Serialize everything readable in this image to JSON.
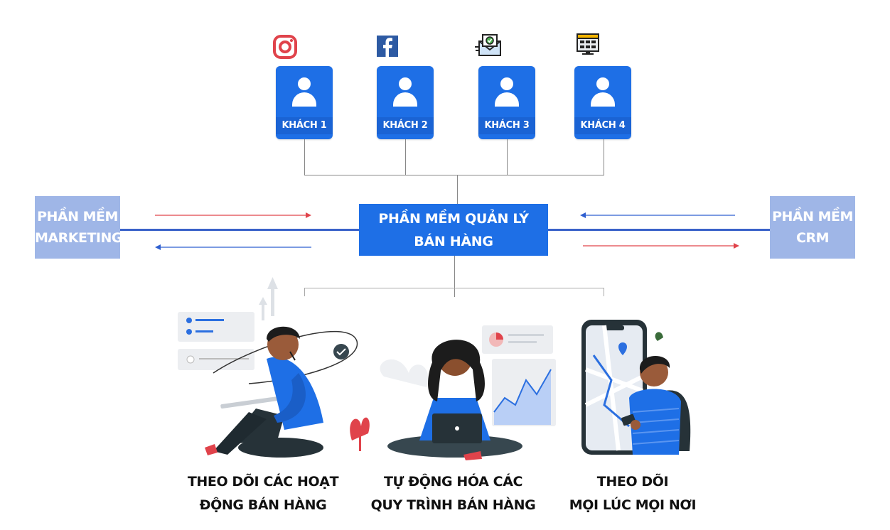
{
  "customers": [
    {
      "label": "KHÁCH 1",
      "channel_icon": "instagram-icon"
    },
    {
      "label": "KHÁCH 2",
      "channel_icon": "facebook-icon"
    },
    {
      "label": "KHÁCH 3",
      "channel_icon": "email-icon"
    },
    {
      "label": "KHÁCH 4",
      "channel_icon": "website-icon"
    }
  ],
  "center": {
    "line1": "PHẦN MỀM QUẢN LÝ",
    "line2": "BÁN HÀNG"
  },
  "left_system": {
    "line1": "PHẦN MỀM",
    "line2": "MARKETING"
  },
  "right_system": {
    "line1": "PHẦN MỀM",
    "line2": "CRM"
  },
  "features": [
    {
      "line1": "THEO DÕI CÁC HOẠT",
      "line2": "ĐỘNG BÁN HÀNG"
    },
    {
      "line1": "TỰ ĐỘNG HÓA CÁC",
      "line2": "QUY TRÌNH BÁN HÀNG"
    },
    {
      "line1": "THEO DÕI",
      "line2": "MỌI LÚC MỌI NƠI"
    }
  ],
  "colors": {
    "primary_blue": "#1e6fe6",
    "light_blue": "#9fb6e7",
    "arrow_red": "#e0434b",
    "arrow_blue": "#2f5fd0"
  }
}
